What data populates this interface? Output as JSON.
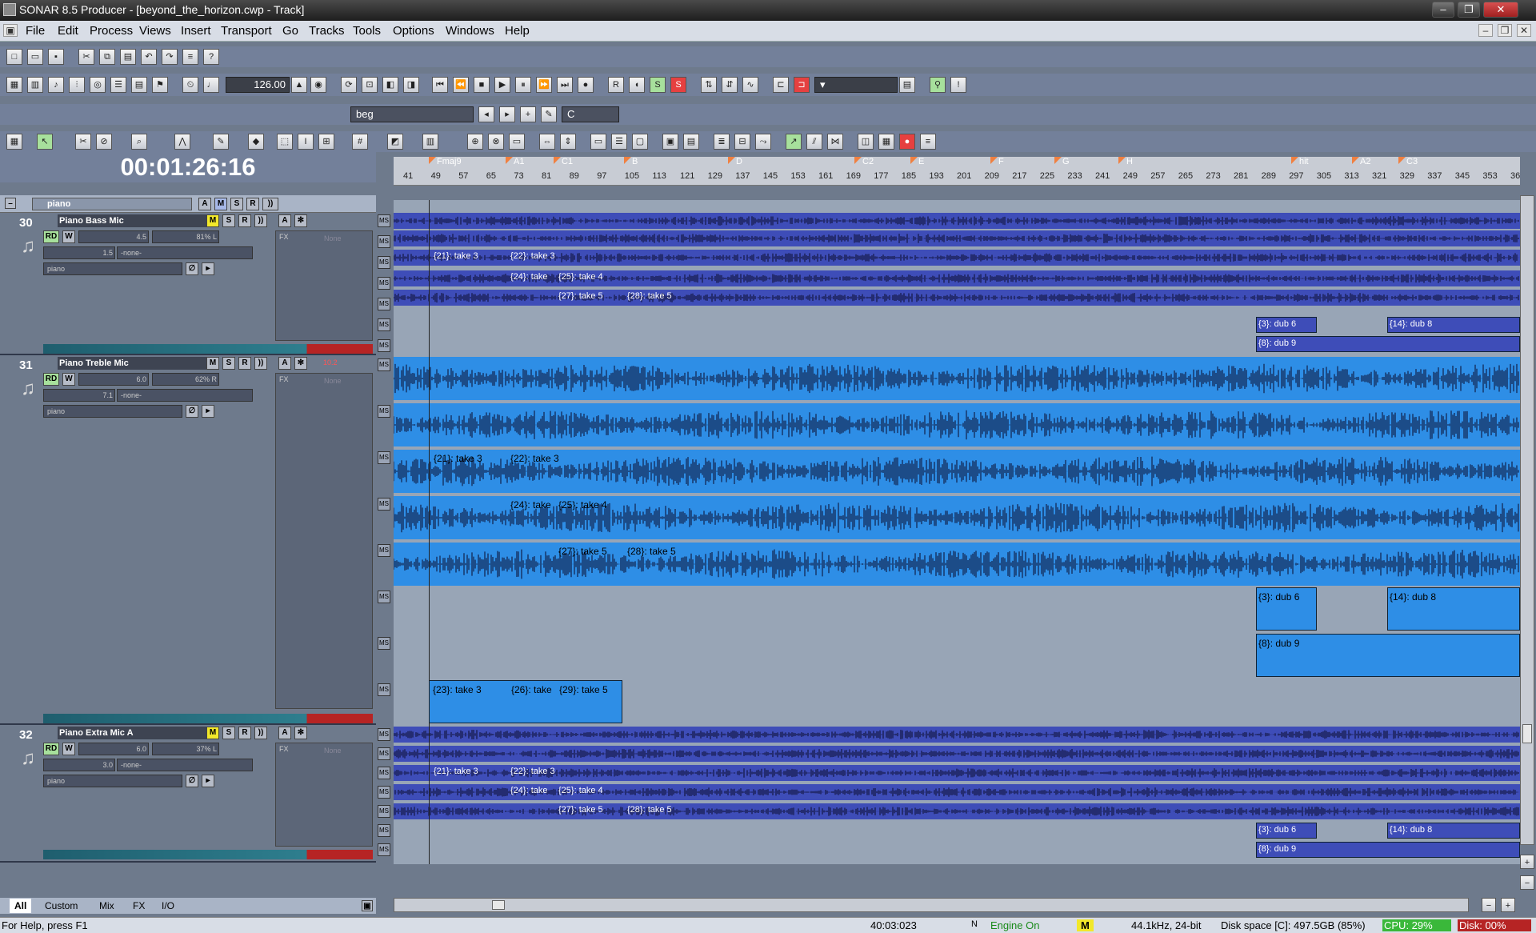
{
  "window": {
    "title": "SONAR 8.5 Producer - [beyond_the_horizon.cwp - Track]"
  },
  "menu": [
    "File",
    "Edit",
    "Process",
    "Views",
    "Insert",
    "Transport",
    "Go",
    "Tracks",
    "Tools",
    "Options",
    "Windows",
    "Help"
  ],
  "transport": {
    "tempo": "126.00",
    "time": "00:01:26:16"
  },
  "combos": {
    "marker": "beg",
    "key": "C"
  },
  "ruler": {
    "markers": [
      "Fmaj9",
      "A1",
      "C1",
      "B",
      "D",
      "C2",
      "E",
      "F",
      "G",
      "H",
      "hit",
      "A2",
      "C3"
    ],
    "ticks": [
      "41",
      "49",
      "57",
      "65",
      "73",
      "81",
      "89",
      "97",
      "105",
      "113",
      "121",
      "129",
      "137",
      "145",
      "153",
      "161",
      "169",
      "177",
      "185",
      "193",
      "201",
      "209",
      "217",
      "225",
      "233",
      "241",
      "249",
      "257",
      "265",
      "273",
      "281",
      "289",
      "297",
      "305",
      "313",
      "321",
      "329",
      "337",
      "345",
      "353",
      "36"
    ]
  },
  "folder": {
    "name": "piano",
    "buttons": [
      "A",
      "M",
      "S",
      "R",
      "))"
    ]
  },
  "tracks": [
    {
      "num": "30",
      "name": "Piano Bass Mic",
      "vol": "4.5",
      "pan": "81% L",
      "trim": "1.5",
      "input": "-none-",
      "output": "piano",
      "fx": "FX",
      "fxslot": "None"
    },
    {
      "num": "31",
      "name": "Piano Treble Mic",
      "vol": "6.0",
      "pan": "62% R",
      "trim": "7.1",
      "input": "-none-",
      "output": "piano",
      "fx": "FX",
      "fxslot": "None",
      "peak": "10.2"
    },
    {
      "num": "32",
      "name": "Piano Extra Mic A",
      "vol": "6.0",
      "pan": "37% L",
      "trim": "3.0",
      "input": "-none-",
      "output": "piano",
      "fx": "FX",
      "fxslot": "None"
    }
  ],
  "strip_buttons": {
    "m": "M",
    "s": "S",
    "r": "R",
    "a": "A",
    "rd": "RD",
    "w": "W"
  },
  "clips": {
    "t21": "{21}: take 3",
    "t22": "{22}: take 3",
    "t24": "{24}: take",
    "t25": "{25}: take 4",
    "t27": "{27}: take 5",
    "t28": "{28}: take 5",
    "d3": "{3}: dub 6",
    "d14": "{14}: dub  8",
    "d8": "{8}: dub 9",
    "t23": "{23}: take 3",
    "t26": "{26}: take",
    "t29": "{29}: take 5"
  },
  "bottom_tabs": [
    "All",
    "Custom",
    "Mix",
    "FX",
    "I/O"
  ],
  "status": {
    "help": "For Help, press F1",
    "position": "40:03:023",
    "n": "N",
    "engine": "Engine On",
    "m": "M",
    "format": "44.1kHz, 24-bit",
    "disk_space": "Disk space [C]: 497.5GB (85%)",
    "cpu": "CPU: 29%",
    "disk": "Disk: 00%"
  },
  "colors": {
    "lane_dark": "#3e4db8",
    "lane_light": "#2e8ee6",
    "marker": "#f08040"
  }
}
